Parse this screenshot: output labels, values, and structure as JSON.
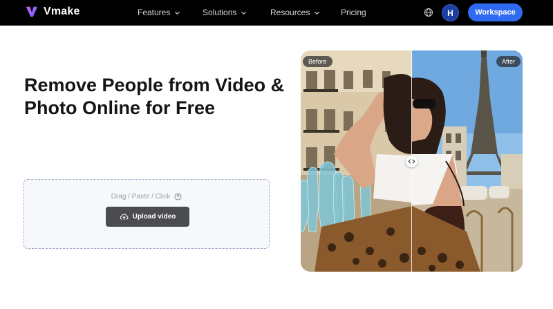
{
  "nav": {
    "logo_text": "Vmake",
    "items": [
      {
        "label": "Features",
        "has_dropdown": true
      },
      {
        "label": "Solutions",
        "has_dropdown": true
      },
      {
        "label": "Resources",
        "has_dropdown": true
      },
      {
        "label": "Pricing",
        "has_dropdown": false
      }
    ],
    "globe_icon": "globe-icon",
    "avatar_initial": "H",
    "workspace_label": "Workspace"
  },
  "hero": {
    "title": "Remove People from Video & Photo Online for Free"
  },
  "upload": {
    "hint": "Drag / Paste / Click",
    "button_label": "Upload video"
  },
  "compare": {
    "before_label": "Before",
    "after_label": "After"
  },
  "colors": {
    "nav_bg": "#000000",
    "accent": "#2f6bf0",
    "upload_button": "#4a4c50",
    "highlight_overlay": "#7fc6d6"
  }
}
